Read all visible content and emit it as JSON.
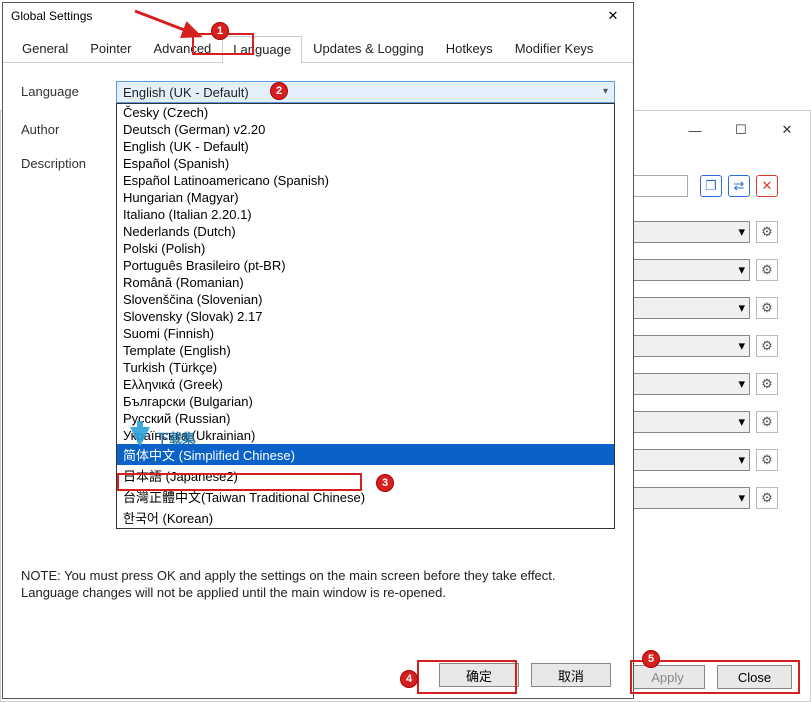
{
  "dialog": {
    "title": "Global Settings",
    "close_glyph": "✕",
    "tabs": [
      "General",
      "Pointer",
      "Advanced",
      "Language",
      "Updates & Logging",
      "Hotkeys",
      "Modifier Keys"
    ],
    "active_tab_index": 3,
    "labels": {
      "language": "Language",
      "author": "Author",
      "description": "Description"
    },
    "combo_value": "English (UK - Default)",
    "dropdown_items": [
      "Česky (Czech)",
      "Deutsch (German) v2.20",
      "English (UK - Default)",
      "Español (Spanish)",
      "Español Latinoamericano (Spanish)",
      "Hungarian (Magyar)",
      "Italiano (Italian 2.20.1)",
      "Nederlands (Dutch)",
      "Polski (Polish)",
      "Português Brasileiro (pt-BR)",
      "Română (Romanian)",
      "Slovenščina (Slovenian)",
      "Slovensky (Slovak) 2.17",
      "Suomi (Finnish)",
      "Template (English)",
      "Turkish (Türkçe)",
      "Ελληνικά (Greek)",
      "Български (Bulgarian)",
      "Русский (Russian)",
      "Українська (Ukrainian)",
      "简体中文 (Simplified Chinese)",
      "日本語 (Japanese2)",
      "台灣正體中文(Taiwan Traditional Chinese)",
      "한국어 (Korean)"
    ],
    "selected_dropdown_index": 20,
    "note": "NOTE: You must press OK and apply the settings on the main screen before they take effect. Language changes will not be applied until the main window is re-opened.",
    "buttons": {
      "ok": "确定",
      "cancel": "取消"
    }
  },
  "background": {
    "buttons": {
      "apply": "Apply",
      "close": "Close"
    },
    "sys": {
      "min": "—",
      "max": "☐",
      "close": "✕"
    }
  },
  "badges": {
    "b1": "1",
    "b2": "2",
    "b3": "3",
    "b4": "4",
    "b5": "5"
  },
  "icons": {
    "caret": "▾",
    "gear": "⚙",
    "copy": "❐",
    "swap": "⇄",
    "del": "✕"
  },
  "watermark": "下载集"
}
